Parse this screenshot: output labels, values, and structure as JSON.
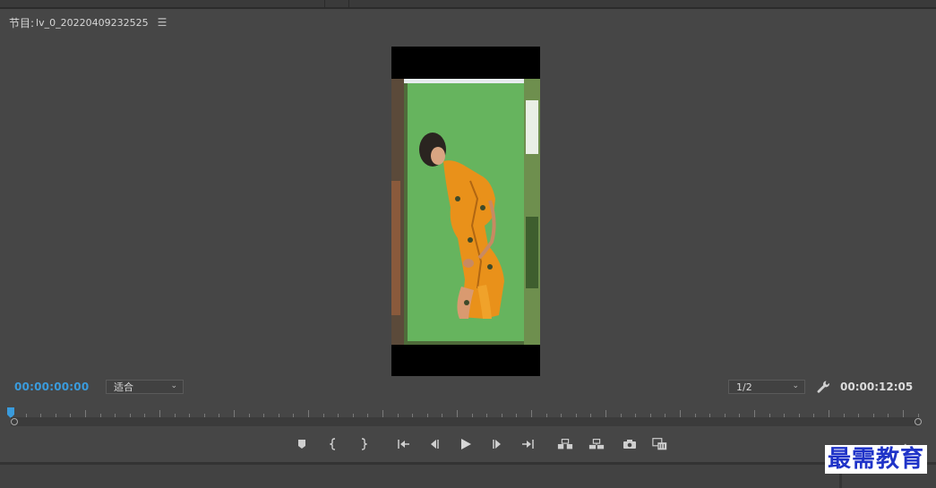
{
  "panel": {
    "title_label": "节目:",
    "sequence_name": "lv_0_20220409232525",
    "menu_icon": "hamburger-menu-icon"
  },
  "monitor": {
    "current_timecode": "00:00:00:00",
    "duration_timecode": "00:00:12:05",
    "zoom_selected": "适合",
    "resolution_selected": "1/2",
    "settings_icon": "wrench-icon",
    "playhead_position": 0
  },
  "transport": {
    "buttons": [
      "add-marker-icon",
      "mark-in-icon",
      "mark-out-icon",
      "go-to-in-icon",
      "step-back-icon",
      "play-icon",
      "step-forward-icon",
      "go-to-out-icon",
      "lift-icon",
      "extract-icon",
      "export-frame-icon",
      "comparison-view-icon"
    ]
  },
  "colors": {
    "accent_timecode": "#3a9bdc",
    "panel_bg": "#464646",
    "green_screen": "#66b45e"
  },
  "watermark": {
    "text": "最需教育"
  }
}
